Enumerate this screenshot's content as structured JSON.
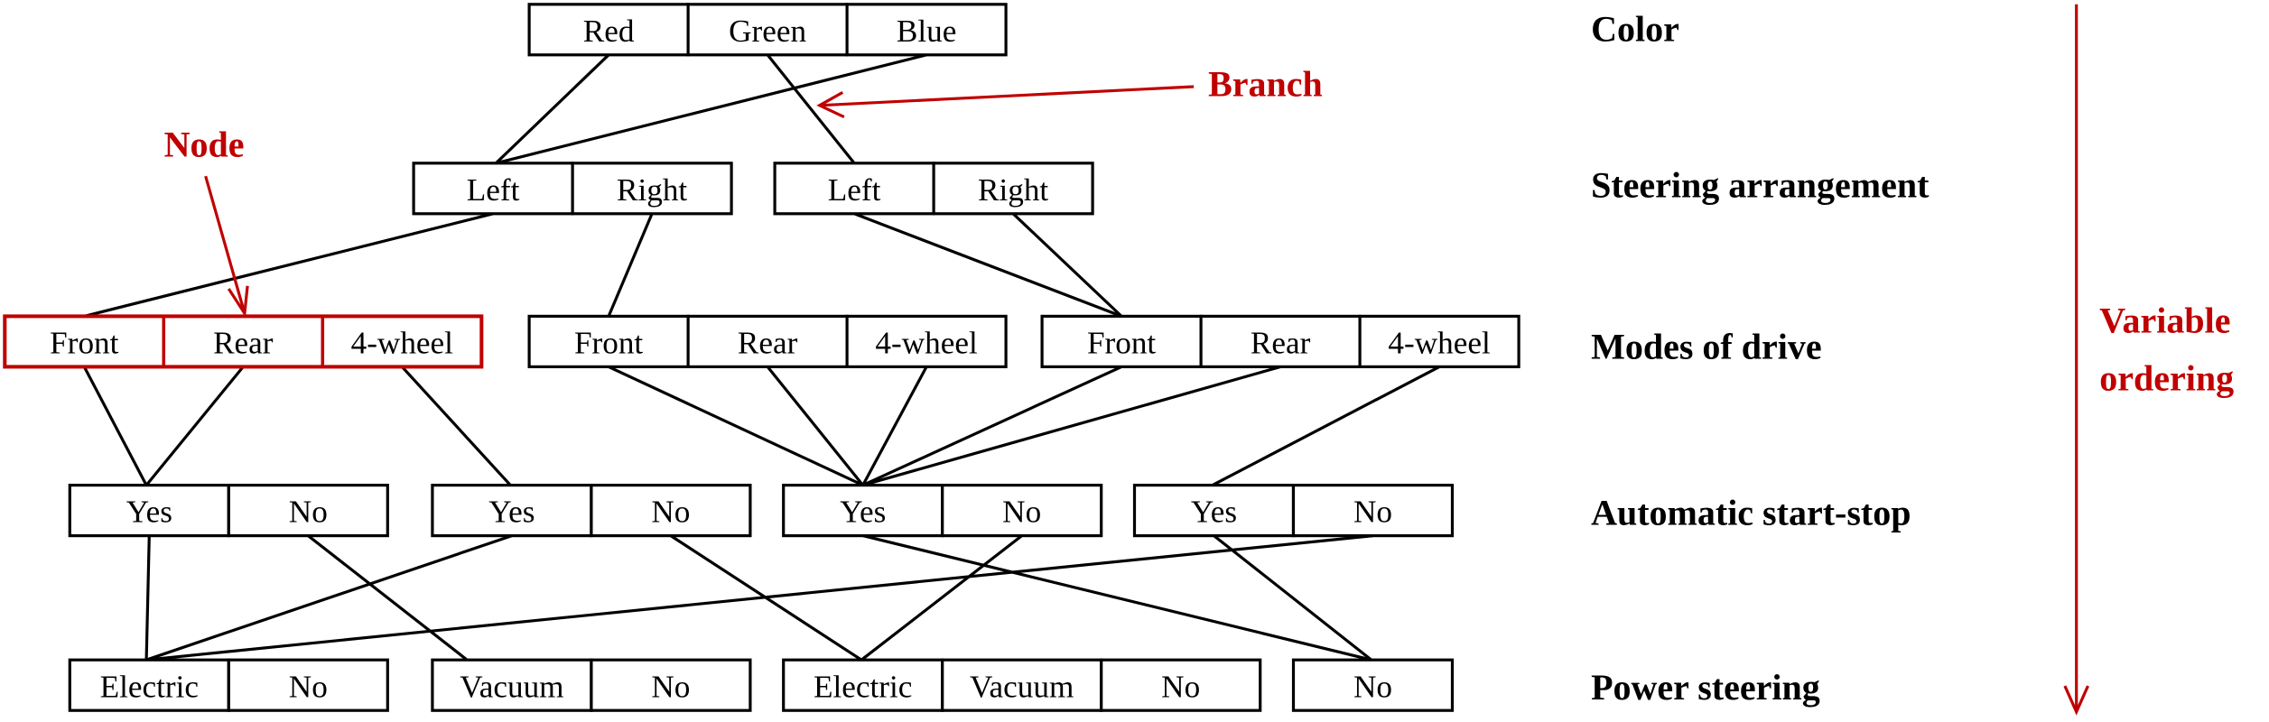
{
  "levels": [
    "Color",
    "Steering arrangement",
    "Modes of drive",
    "Automatic start-stop",
    "Power steering"
  ],
  "annotations": {
    "branch": "Branch",
    "node": "Node",
    "ordering_line1": "Variable",
    "ordering_line2": "ordering",
    "color": "#c00000"
  },
  "nodes": [
    {
      "level": 0,
      "cells": [
        "Red",
        "Green",
        "Blue"
      ]
    },
    {
      "level": 1,
      "cells": [
        "Left",
        "Right"
      ]
    },
    {
      "level": 1,
      "cells": [
        "Left",
        "Right"
      ]
    },
    {
      "level": 2,
      "cells": [
        "Front",
        "Rear",
        "4-wheel"
      ],
      "highlighted": true
    },
    {
      "level": 2,
      "cells": [
        "Front",
        "Rear",
        "4-wheel"
      ]
    },
    {
      "level": 2,
      "cells": [
        "Front",
        "Rear",
        "4-wheel"
      ]
    },
    {
      "level": 3,
      "cells": [
        "Yes",
        "No"
      ]
    },
    {
      "level": 3,
      "cells": [
        "Yes",
        "No"
      ]
    },
    {
      "level": 3,
      "cells": [
        "Yes",
        "No"
      ]
    },
    {
      "level": 3,
      "cells": [
        "Yes",
        "No"
      ]
    },
    {
      "level": 4,
      "cells": [
        "Electric",
        "No"
      ]
    },
    {
      "level": 4,
      "cells": [
        "Vacuum",
        "No"
      ]
    },
    {
      "level": 4,
      "cells": [
        "Electric",
        "Vacuum",
        "No"
      ]
    },
    {
      "level": 4,
      "cells": [
        "No"
      ]
    }
  ],
  "branches": [
    {
      "from": [
        0,
        0
      ],
      "to": 1
    },
    {
      "from": [
        0,
        2
      ],
      "to": 1
    },
    {
      "from": [
        0,
        1
      ],
      "to": 2
    },
    {
      "from": [
        1,
        0
      ],
      "to": 3
    },
    {
      "from": [
        1,
        1
      ],
      "to": 4
    },
    {
      "from": [
        2,
        0
      ],
      "to": 5
    },
    {
      "from": [
        2,
        1
      ],
      "to": 5
    },
    {
      "from": [
        3,
        0
      ],
      "to": 6
    },
    {
      "from": [
        3,
        1
      ],
      "to": 6
    },
    {
      "from": [
        3,
        2
      ],
      "to": 7
    },
    {
      "from": [
        4,
        0
      ],
      "to": 8
    },
    {
      "from": [
        4,
        1
      ],
      "to": 8
    },
    {
      "from": [
        4,
        2
      ],
      "to": 8
    },
    {
      "from": [
        5,
        0
      ],
      "to": 8
    },
    {
      "from": [
        5,
        1
      ],
      "to": 8
    },
    {
      "from": [
        5,
        2
      ],
      "to": 9
    },
    {
      "from": [
        6,
        0
      ],
      "to": 10
    },
    {
      "from": [
        6,
        1
      ],
      "to": 11
    },
    {
      "from": [
        7,
        0
      ],
      "to": 10
    },
    {
      "from": [
        7,
        1
      ],
      "to": 12
    },
    {
      "from": [
        8,
        0
      ],
      "to": 13
    },
    {
      "from": [
        8,
        1
      ],
      "to": 12
    },
    {
      "from": [
        9,
        0
      ],
      "to": 13
    },
    {
      "from": [
        9,
        1
      ],
      "to": 10
    }
  ]
}
